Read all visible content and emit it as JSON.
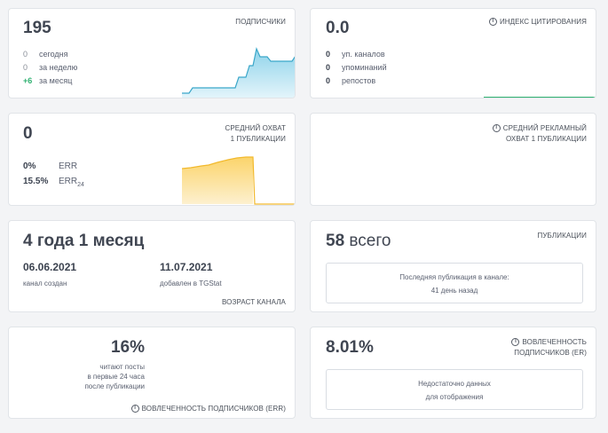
{
  "subscribers": {
    "value": "195",
    "tag": "ПОДПИСЧИКИ",
    "rows": [
      {
        "num": "0",
        "label": "сегодня"
      },
      {
        "num": "0",
        "label": "за неделю"
      },
      {
        "num": "+6",
        "label": "за месяц"
      }
    ]
  },
  "citation": {
    "value": "0.0",
    "tag": "ИНДЕКС ЦИТИРОВАНИЯ",
    "rows": [
      {
        "num": "0",
        "label": "уп. каналов"
      },
      {
        "num": "0",
        "label": "упоминаний"
      },
      {
        "num": "0",
        "label": "репостов"
      }
    ]
  },
  "reach": {
    "value": "0",
    "tag_line1": "СРЕДНИЙ ОХВАТ",
    "tag_line2": "1 ПУБЛИКАЦИИ",
    "err_value": "0%",
    "err_label": "ERR",
    "err24_value": "15.5%",
    "err24_label": "ERR",
    "err24_sub": "24"
  },
  "ad_reach": {
    "tag_line1": "СРЕДНИЙ РЕКЛАМНЫЙ",
    "tag_line2": "ОХВАТ 1 ПУБЛИКАЦИИ"
  },
  "age": {
    "value": "4 года 1 месяц",
    "created_date": "06.06.2021",
    "created_label": "канал создан",
    "added_date": "11.07.2021",
    "added_label": "добавлен в TGStat",
    "tag": "ВОЗРАСТ КАНАЛА"
  },
  "publications": {
    "count": "58",
    "count_suffix": "всего",
    "tag": "ПУБЛИКАЦИИ",
    "last_line1": "Последняя публикация в канале:",
    "last_line2": "41 день назад"
  },
  "err24": {
    "value": "16%",
    "desc_line1": "читают посты",
    "desc_line2": "в первые 24 часа",
    "desc_line3": "после публикации",
    "tag": "ВОВЛЕЧЕННОСТЬ ПОДПИСЧИКОВ (ERR)"
  },
  "er": {
    "value": "8.01%",
    "tag_line1": "ВОВЛЕЧЕННОСТЬ",
    "tag_line2": "ПОДПИСЧИКОВ (ER)",
    "empty_line1": "Недостаточно данных",
    "empty_line2": "для отображения"
  },
  "colors": {
    "subscribers_line": "#3ba7c9",
    "reach_line": "#f2b92c",
    "citation_line": "#2fb171"
  }
}
